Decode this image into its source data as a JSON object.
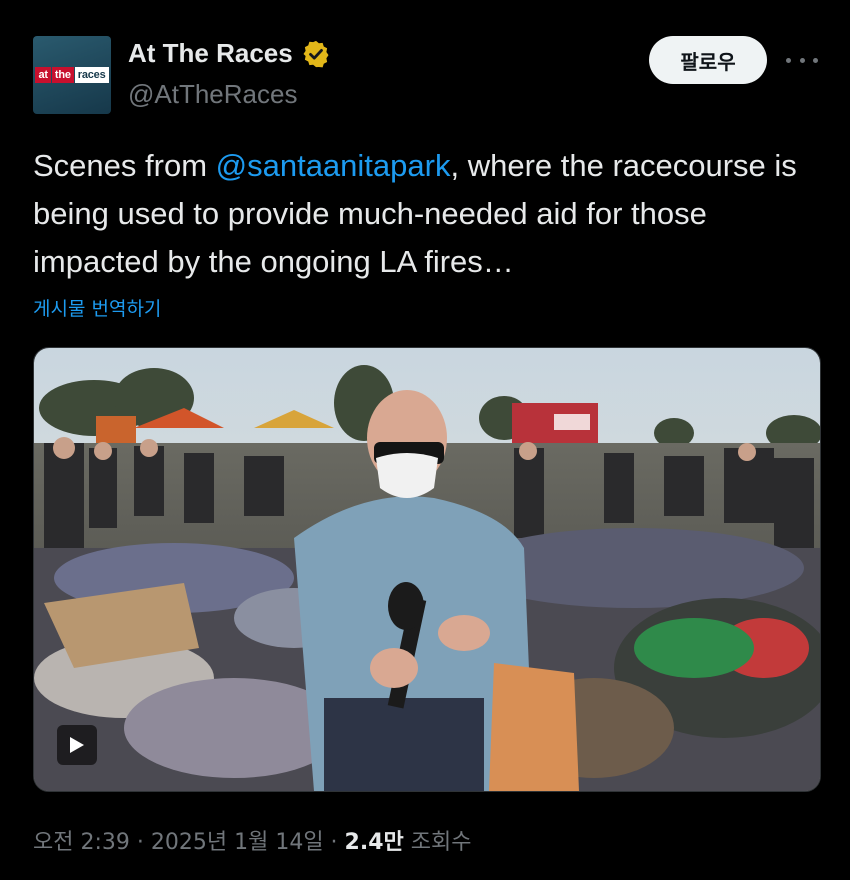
{
  "account": {
    "display_name": "At The Races",
    "handle": "@AtTheRaces",
    "verified_icon": "verified-badge-icon",
    "logo": {
      "part1": "at",
      "part2": "the",
      "part3": "races"
    }
  },
  "actions": {
    "follow_label": "팔로우",
    "more_icon": "more-options-icon"
  },
  "tweet": {
    "text_before": "Scenes from ",
    "mention": "@santaanitapark",
    "text_after": ", where the racecourse is being used to provide much-needed aid for those impacted by the ongoing LA fires…",
    "translate_label": "게시물 번역하기"
  },
  "media": {
    "type": "video",
    "play_icon": "play-icon"
  },
  "meta": {
    "time": "오전 2:39",
    "sep1": " · ",
    "date": "2025년 1월 14일",
    "sep2": " · ",
    "views_count": "2.4만",
    "views_label": " 조회수"
  },
  "colors": {
    "background": "#000000",
    "text": "#e7e9ea",
    "secondary": "#71767b",
    "link": "#1d9bf0",
    "verified": "#e2b719"
  }
}
